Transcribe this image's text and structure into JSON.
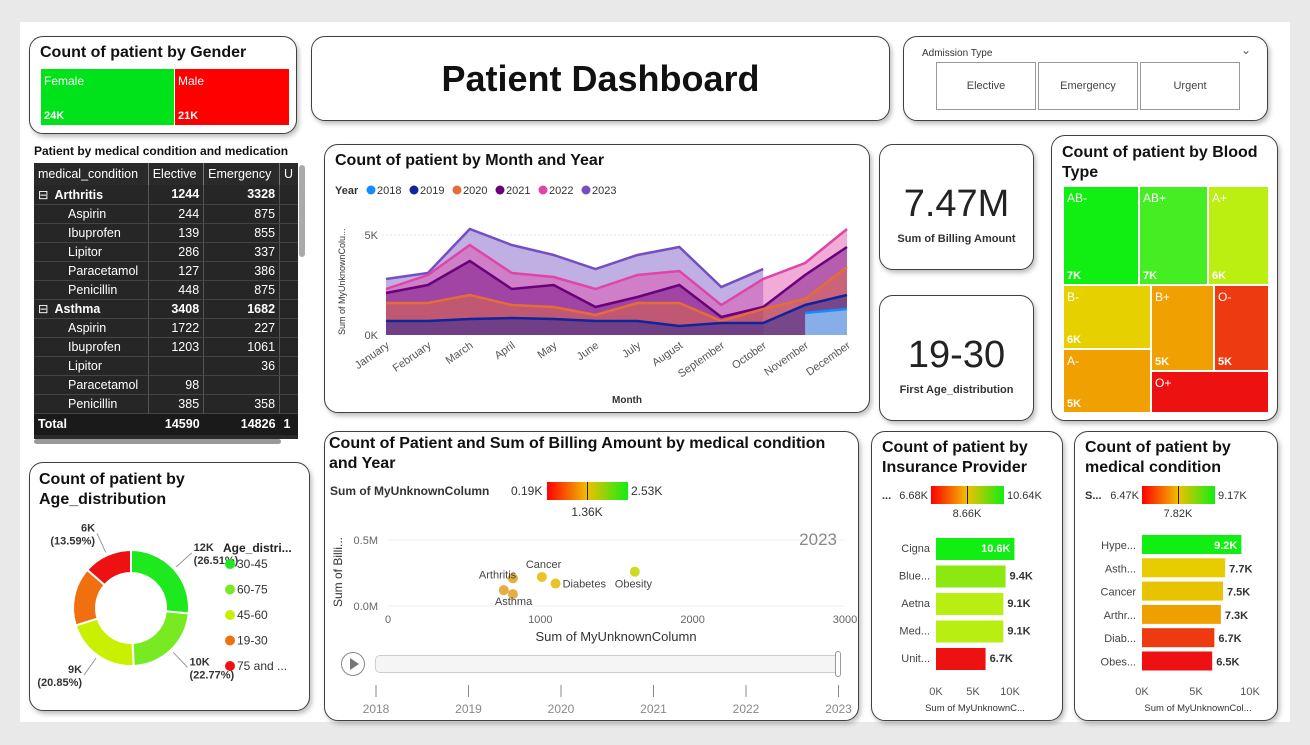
{
  "title": "Patient Dashboard",
  "gender": {
    "title": "Count of patient by Gender",
    "female_label": "Female",
    "female_value": "24K",
    "male_label": "Male",
    "male_value": "21K",
    "female_color": "#00e31a",
    "male_color": "#ff0000"
  },
  "slicer": {
    "title": "Admission Type",
    "options": [
      "Elective",
      "Emergency",
      "Urgent"
    ]
  },
  "matrix": {
    "title": "Patient by medical condition and medication",
    "headers": [
      "medical_condition",
      "Elective",
      "Emergency",
      "U"
    ],
    "rows": [
      {
        "label": "Arthritis",
        "elective": "1244",
        "emergency": "3328",
        "level": "group"
      },
      {
        "label": "Aspirin",
        "elective": "244",
        "emergency": "875",
        "level": "child"
      },
      {
        "label": "Ibuprofen",
        "elective": "139",
        "emergency": "855",
        "level": "child"
      },
      {
        "label": "Lipitor",
        "elective": "286",
        "emergency": "337",
        "level": "child"
      },
      {
        "label": "Paracetamol",
        "elective": "127",
        "emergency": "386",
        "level": "child"
      },
      {
        "label": "Penicillin",
        "elective": "448",
        "emergency": "875",
        "level": "child"
      },
      {
        "label": "Asthma",
        "elective": "3408",
        "emergency": "1682",
        "level": "group"
      },
      {
        "label": "Aspirin",
        "elective": "1722",
        "emergency": "227",
        "level": "child"
      },
      {
        "label": "Ibuprofen",
        "elective": "1203",
        "emergency": "1061",
        "level": "child"
      },
      {
        "label": "Lipitor",
        "elective": "",
        "emergency": "36",
        "level": "child"
      },
      {
        "label": "Paracetamol",
        "elective": "98",
        "emergency": "",
        "level": "child"
      },
      {
        "label": "Penicillin",
        "elective": "385",
        "emergency": "358",
        "level": "child"
      }
    ],
    "total": {
      "label": "Total",
      "elective": "14590",
      "emergency": "14826",
      "extra": "1"
    }
  },
  "age_donut": {
    "title": "Count of patient by Age_distribution",
    "legend_title": "Age_distri...",
    "slices": [
      {
        "label": "30-45",
        "value_label": "12K",
        "pct_label": "(26.51%)",
        "pct": 26.51,
        "color": "#1ee81e"
      },
      {
        "label": "60-75",
        "value_label": "10K",
        "pct_label": "(22.77%)",
        "pct": 22.77,
        "color": "#77ea22"
      },
      {
        "label": "45-60",
        "value_label": "9K",
        "pct_label": "(20.85%)",
        "pct": 20.85,
        "color": "#c8f000"
      },
      {
        "label": "19-30",
        "value_label": "",
        "pct_label": "",
        "pct": 16.28,
        "color": "#f07010"
      },
      {
        "label": "75 and ...",
        "value_label": "6K",
        "pct_label": "(13.59%)",
        "pct": 13.59,
        "color": "#ee1111"
      }
    ]
  },
  "kpi_billing": {
    "value": "7.47M",
    "label": "Sum of Billing Amount"
  },
  "kpi_age": {
    "value": "19-30",
    "label": "First Age_distribution"
  },
  "blood": {
    "title": "Count of patient by Blood Type",
    "cells": [
      {
        "label": "AB-",
        "value": "7K",
        "color": "#11ee11"
      },
      {
        "label": "AB+",
        "value": "7K",
        "color": "#44ee22"
      },
      {
        "label": "A+",
        "value": "6K",
        "color": "#bbee11"
      },
      {
        "label": "B-",
        "value": "6K",
        "color": "#e6d000"
      },
      {
        "label": "B+",
        "value": "5K",
        "color": "#f0a000"
      },
      {
        "label": "O-",
        "value": "5K",
        "color": "#ee3a10"
      },
      {
        "label": "A-",
        "value": "5K",
        "color": "#f0a000"
      },
      {
        "label": "O+",
        "value": "",
        "color": "#ee1111"
      }
    ]
  },
  "month_chart": {
    "title": "Count of patient by Month and Year",
    "legend_title": "Year",
    "ylabel": "Sum of MyUnknownColu...",
    "xlabel": "Month",
    "y_ticks": [
      "5K",
      "0K"
    ],
    "chart_data": {
      "type": "area",
      "categories": [
        "January",
        "February",
        "March",
        "April",
        "May",
        "June",
        "July",
        "August",
        "September",
        "October",
        "November",
        "December"
      ],
      "ylim": [
        0,
        6500
      ],
      "series": [
        {
          "name": "2018",
          "color": "#118dff",
          "values": [
            null,
            null,
            null,
            null,
            null,
            null,
            null,
            null,
            null,
            null,
            1100,
            1300
          ]
        },
        {
          "name": "2019",
          "color": "#12239e",
          "values": [
            700,
            700,
            800,
            850,
            800,
            700,
            700,
            450,
            600,
            600,
            1500,
            2000
          ]
        },
        {
          "name": "2020",
          "color": "#e66c37",
          "values": [
            1600,
            1600,
            2000,
            1500,
            1400,
            1000,
            1600,
            1600,
            700,
            1300,
            1800,
            3400
          ]
        },
        {
          "name": "2021",
          "color": "#6b007b",
          "values": [
            2100,
            2500,
            3700,
            2300,
            2500,
            1400,
            1900,
            2500,
            900,
            1400,
            3000,
            4400
          ]
        },
        {
          "name": "2022",
          "color": "#e044a7",
          "values": [
            2300,
            3000,
            4500,
            3100,
            2900,
            2300,
            3000,
            3200,
            1500,
            2800,
            3600,
            5300
          ]
        },
        {
          "name": "2023",
          "color": "#744ec2",
          "values": [
            2800,
            3100,
            5300,
            4500,
            4000,
            3300,
            4000,
            4400,
            2400,
            3300,
            null,
            null
          ]
        }
      ]
    }
  },
  "scatter": {
    "title": "Count of Patient and Sum of Billing Amount by medical condition and Year",
    "gradient_label": "Sum of MyUnknownColumn",
    "grad_min": "0.19K",
    "grad_max": "2.53K",
    "grad_mid": "1.36K",
    "ylabel": "Sum of Billi...",
    "xlabel": "Sum of MyUnknownColumn",
    "year_watermark": "2023",
    "y_ticks": [
      "0.5M",
      "0.0M"
    ],
    "x_ticks": [
      "0",
      "1000",
      "2000",
      "3000"
    ],
    "timeline": [
      "2018",
      "2019",
      "2020",
      "2021",
      "2022",
      "2023"
    ],
    "chart_data": {
      "type": "scatter",
      "xlim": [
        0,
        3000
      ],
      "ylim": [
        0,
        0.5
      ],
      "points": [
        {
          "label": "Arthritis",
          "x": 820,
          "y": 0.21,
          "color": "#e0a020"
        },
        {
          "label": "Asthma",
          "x": 820,
          "y": 0.09,
          "color": "#e0a020"
        },
        {
          "label": "",
          "x": 760,
          "y": 0.12,
          "color": "#e0a020"
        },
        {
          "label": "Cancer",
          "x": 1010,
          "y": 0.22,
          "color": "#e6b800"
        },
        {
          "label": "Diabetes",
          "x": 1100,
          "y": 0.17,
          "color": "#e6b800"
        },
        {
          "label": "Obesity",
          "x": 1620,
          "y": 0.26,
          "color": "#c8d400"
        }
      ]
    }
  },
  "insurance": {
    "title": "Count of patient by Insurance Provider",
    "legend_abbrev": "...",
    "grad_min": "6.68K",
    "grad_max": "10.64K",
    "grad_mid": "8.66K",
    "xlabel": "Sum of MyUnknownC...",
    "x_ticks": [
      "0K",
      "5K",
      "10K"
    ],
    "chart_data": {
      "type": "bar",
      "xlim": [
        0,
        10000
      ],
      "bars": [
        {
          "label": "Cigna",
          "value": 10600,
          "value_label": "10.6K",
          "color": "#11ee11"
        },
        {
          "label": "Blue...",
          "value": 9400,
          "value_label": "9.4K",
          "color": "#8ce811"
        },
        {
          "label": "Aetna",
          "value": 9100,
          "value_label": "9.1K",
          "color": "#b8ee11"
        },
        {
          "label": "Med...",
          "value": 9100,
          "value_label": "9.1K",
          "color": "#b8ee11"
        },
        {
          "label": "Unit...",
          "value": 6700,
          "value_label": "6.7K",
          "color": "#ee1111"
        }
      ]
    }
  },
  "conditions": {
    "title": "Count of patient by medical condition",
    "legend_abbrev": "S...",
    "grad_min": "6.47K",
    "grad_max": "9.17K",
    "grad_mid": "7.82K",
    "xlabel": "Sum of MyUnknownCol...",
    "x_ticks": [
      "0K",
      "5K",
      "10K"
    ],
    "chart_data": {
      "type": "bar",
      "xlim": [
        0,
        10000
      ],
      "bars": [
        {
          "label": "Hype...",
          "value": 9200,
          "value_label": "9.2K",
          "color": "#11ee11"
        },
        {
          "label": "Asth...",
          "value": 7700,
          "value_label": "7.7K",
          "color": "#e8cc00"
        },
        {
          "label": "Cancer",
          "value": 7500,
          "value_label": "7.5K",
          "color": "#e8c400"
        },
        {
          "label": "Arthr...",
          "value": 7300,
          "value_label": "7.3K",
          "color": "#eea000"
        },
        {
          "label": "Diab...",
          "value": 6700,
          "value_label": "6.7K",
          "color": "#ee3a10"
        },
        {
          "label": "Obes...",
          "value": 6500,
          "value_label": "6.5K",
          "color": "#ee1111"
        }
      ]
    }
  }
}
